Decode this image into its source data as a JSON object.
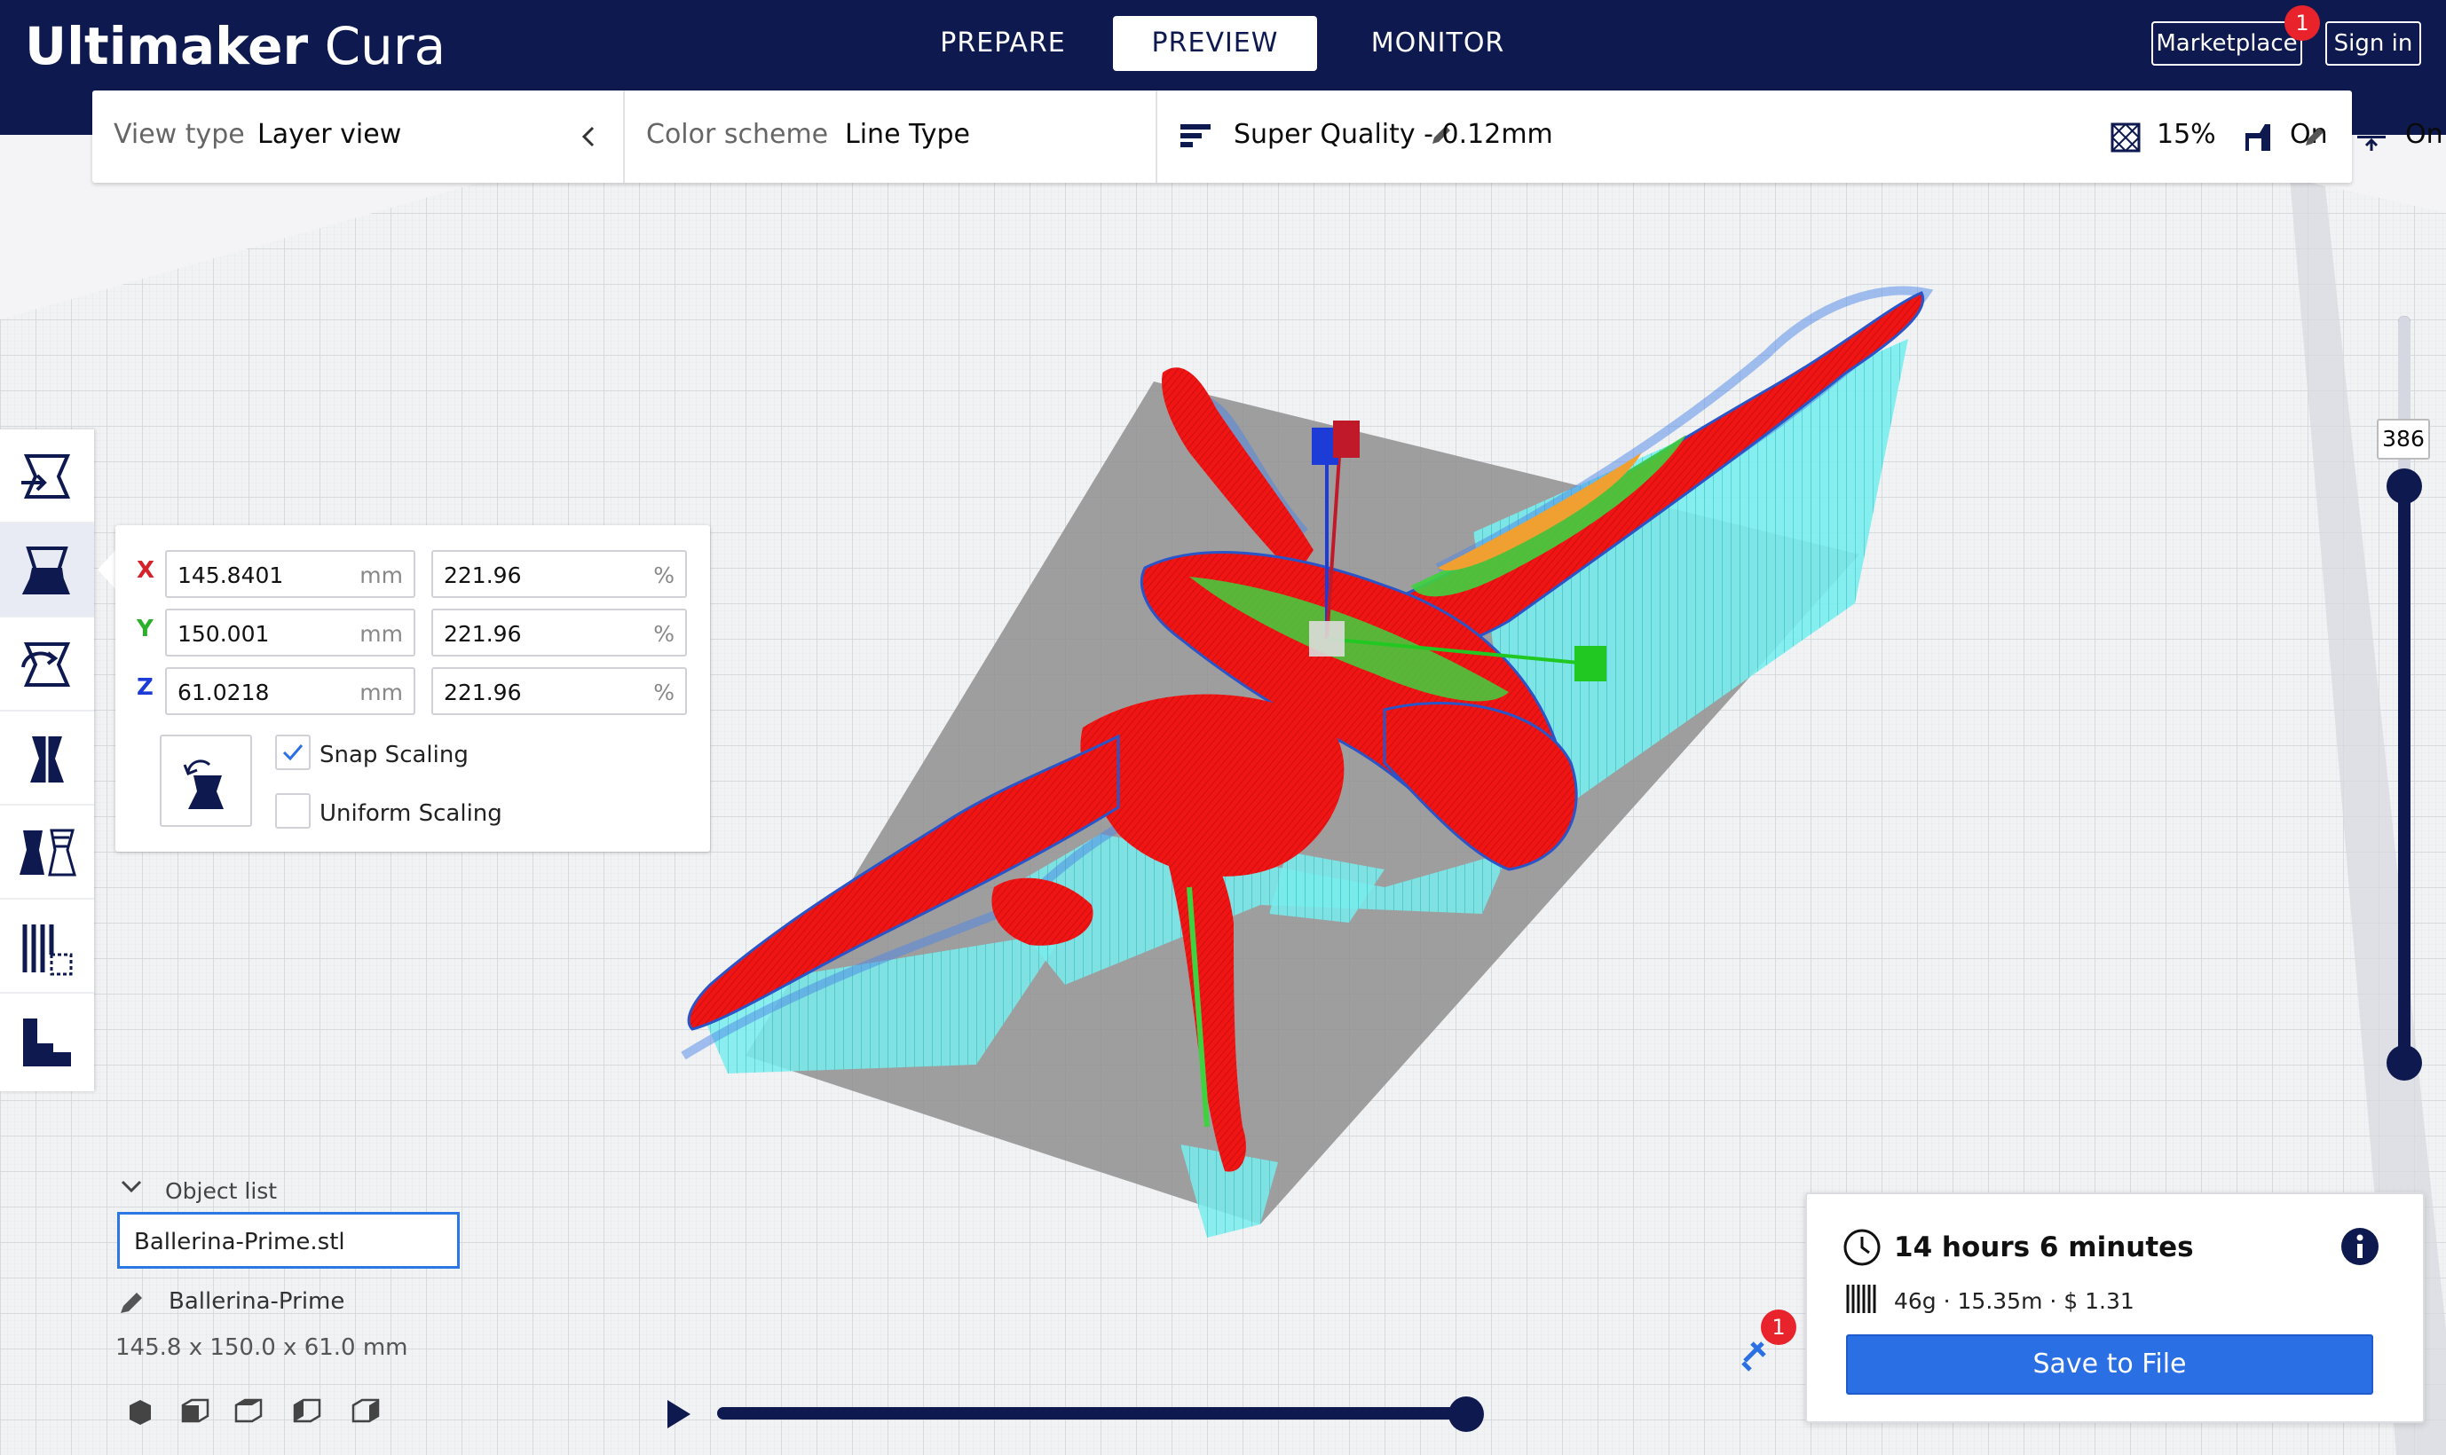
{
  "app": {
    "brand_bold": "Ultimaker",
    "brand_light": "Cura"
  },
  "stages": [
    {
      "label": "PREPARE",
      "active": false
    },
    {
      "label": "PREVIEW",
      "active": true
    },
    {
      "label": "MONITOR",
      "active": false
    }
  ],
  "header": {
    "marketplace_label": "Marketplace",
    "marketplace_badge": "1",
    "signin_label": "Sign in"
  },
  "settings_bar": {
    "view_type_label": "View type",
    "view_type_value": "Layer view",
    "color_scheme_label": "Color scheme",
    "color_scheme_value": "Line Type",
    "quality": "Super Quality - 0.12mm",
    "infill": "15%",
    "support": "On",
    "adhesion": "On"
  },
  "scale_panel": {
    "x_label": "X",
    "x_mm": "145.8401",
    "x_pct": "221.96",
    "y_label": "Y",
    "y_mm": "150.001",
    "y_pct": "221.96",
    "z_label": "Z",
    "z_mm": "61.0218",
    "z_pct": "221.96",
    "mm_unit": "mm",
    "pct_unit": "%",
    "snap_label": "Snap Scaling",
    "snap_checked": true,
    "uniform_label": "Uniform Scaling",
    "uniform_checked": false
  },
  "object_list": {
    "label": "Object list",
    "filename": "Ballerina-Prime.stl",
    "object_name": "Ballerina-Prime",
    "dimensions": "145.8 x 150.0 x 61.0 mm"
  },
  "layer_slider": {
    "current_layer": "386"
  },
  "print_info": {
    "time": "14 hours 6 minutes",
    "cost": "46g · 15.35m · $ 1.31",
    "save_label": "Save to File"
  },
  "extensions_badge": "1",
  "colors": {
    "header": "#0e1a4f",
    "accent": "#2b6fe4",
    "badge": "#e8232b",
    "model_red": "#f01010",
    "support_cyan": "#62e6e6"
  }
}
